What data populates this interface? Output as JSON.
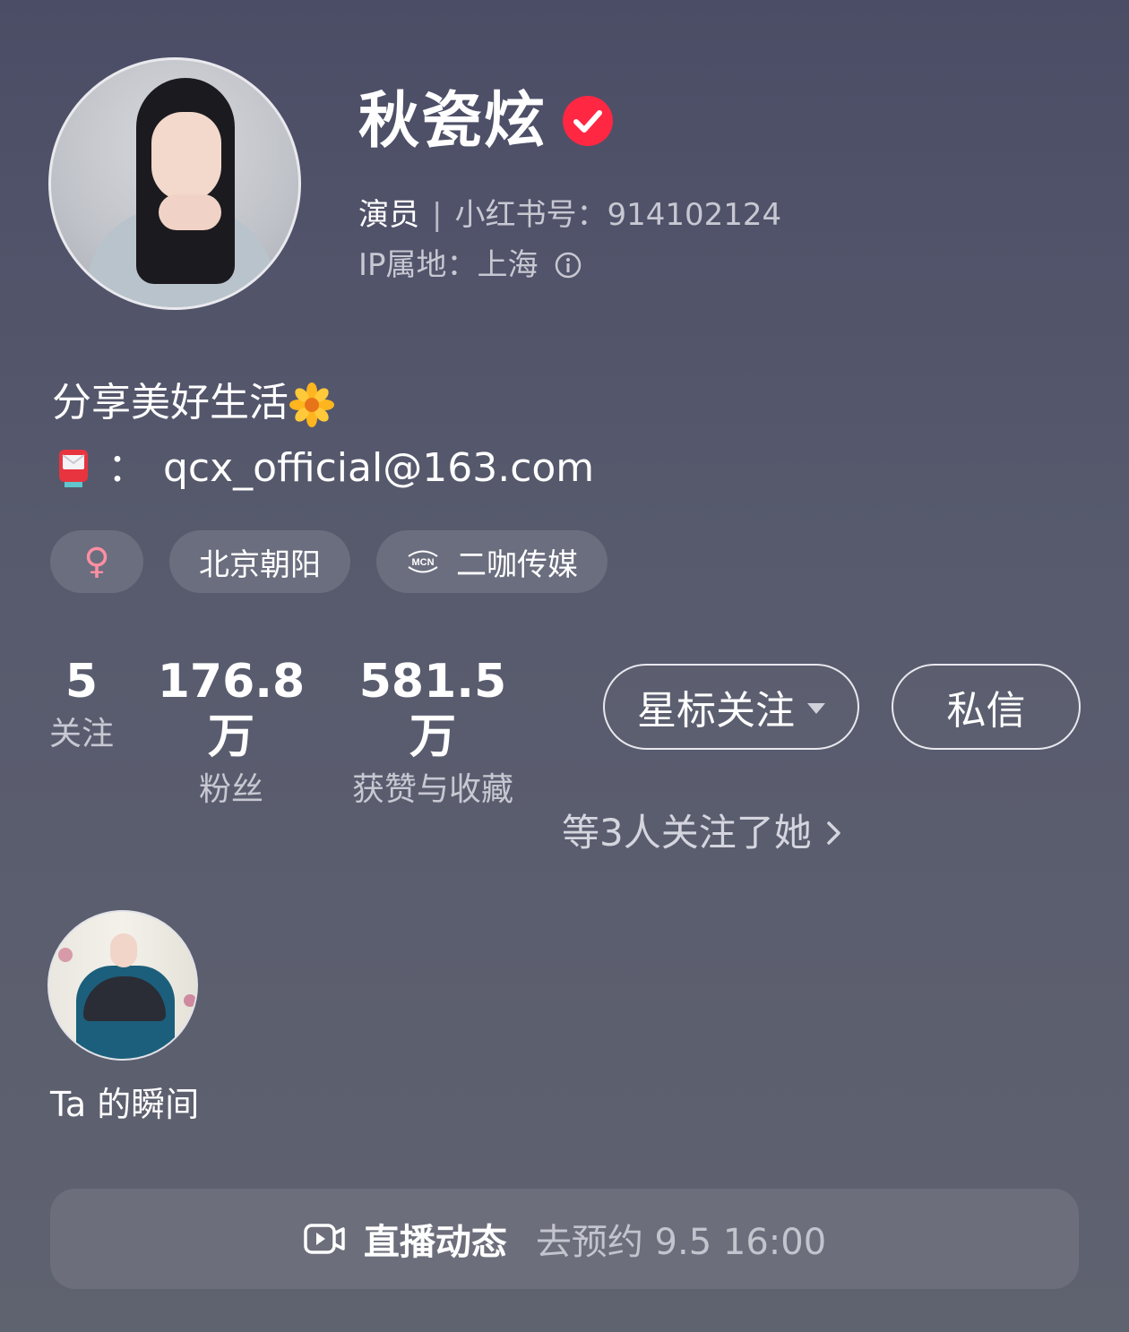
{
  "profile": {
    "name": "秋瓷炫",
    "role": "演员",
    "separator": "|",
    "id_text": "小红书号：914102124",
    "ip_text": "IP属地：上海",
    "bio": "分享美好生活",
    "email_prefix": "：",
    "email": "qcx_official@163.com"
  },
  "tags": {
    "gender_symbol": "♀",
    "location": "北京朝阳",
    "mcn_label": "MCN",
    "mcn": "二咖传媒"
  },
  "stats": [
    {
      "value": "5",
      "label": "关注"
    },
    {
      "value": "176.8万",
      "label": "粉丝"
    },
    {
      "value": "581.5万",
      "label": "获赞与收藏"
    }
  ],
  "actions": {
    "star_follow": "星标关注",
    "message": "私信"
  },
  "mutual_followers": "等3人关注了她",
  "moments": {
    "label": "Ta 的瞬间"
  },
  "live": {
    "title": "直播动态",
    "subtitle": "去预约 9.5 16:00"
  },
  "colors": {
    "verified_badge": "#ff2742",
    "gender_female": "#ff8fa3"
  },
  "icons": {
    "verified": "verified-check-icon",
    "info": "info-icon",
    "flower": "sunflower-emoji",
    "mailbox": "postbox-emoji",
    "mcn": "mcn-icon",
    "chevron": "chevron-right-icon",
    "live": "live-video-icon"
  }
}
